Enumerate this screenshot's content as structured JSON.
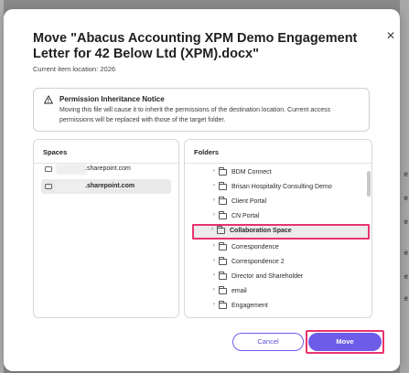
{
  "dialog": {
    "title": "Move \"Abacus Accounting XPM Demo Engagement Letter for 42 Below Ltd (XPM).docx\"",
    "current_location": "Current item location: 2026",
    "close_icon": "close-icon"
  },
  "notice": {
    "icon": "warning-triangle-icon",
    "title": "Permission Inheritance Notice",
    "text": "Moving this file will cause it to inherit the permissions of the destination location. Current access permissions will be replaced with those of the target folder."
  },
  "spaces": {
    "header": "Spaces",
    "items": [
      {
        "label": ".sharepoint.com",
        "selected": false
      },
      {
        "label": ".sharepoint.com",
        "selected": true
      }
    ]
  },
  "folders": {
    "header": "Folders",
    "items": [
      {
        "label": "BDM Connect",
        "selected": false
      },
      {
        "label": "Brisan Hospitality Consulting Demo",
        "selected": false
      },
      {
        "label": "Client Portal",
        "selected": false
      },
      {
        "label": "CN Portal",
        "selected": false
      },
      {
        "label": "Collaboration Space",
        "selected": true
      },
      {
        "label": "Correspondence",
        "selected": false
      },
      {
        "label": "Correspondence 2",
        "selected": false
      },
      {
        "label": "Director and Shareholder",
        "selected": false
      },
      {
        "label": "email",
        "selected": false
      },
      {
        "label": "Engagement",
        "selected": false
      }
    ]
  },
  "actions": {
    "cancel_label": "Cancel",
    "move_label": "Move"
  },
  "colors": {
    "accent": "#6c5ce7",
    "highlight": "#e8336d"
  }
}
